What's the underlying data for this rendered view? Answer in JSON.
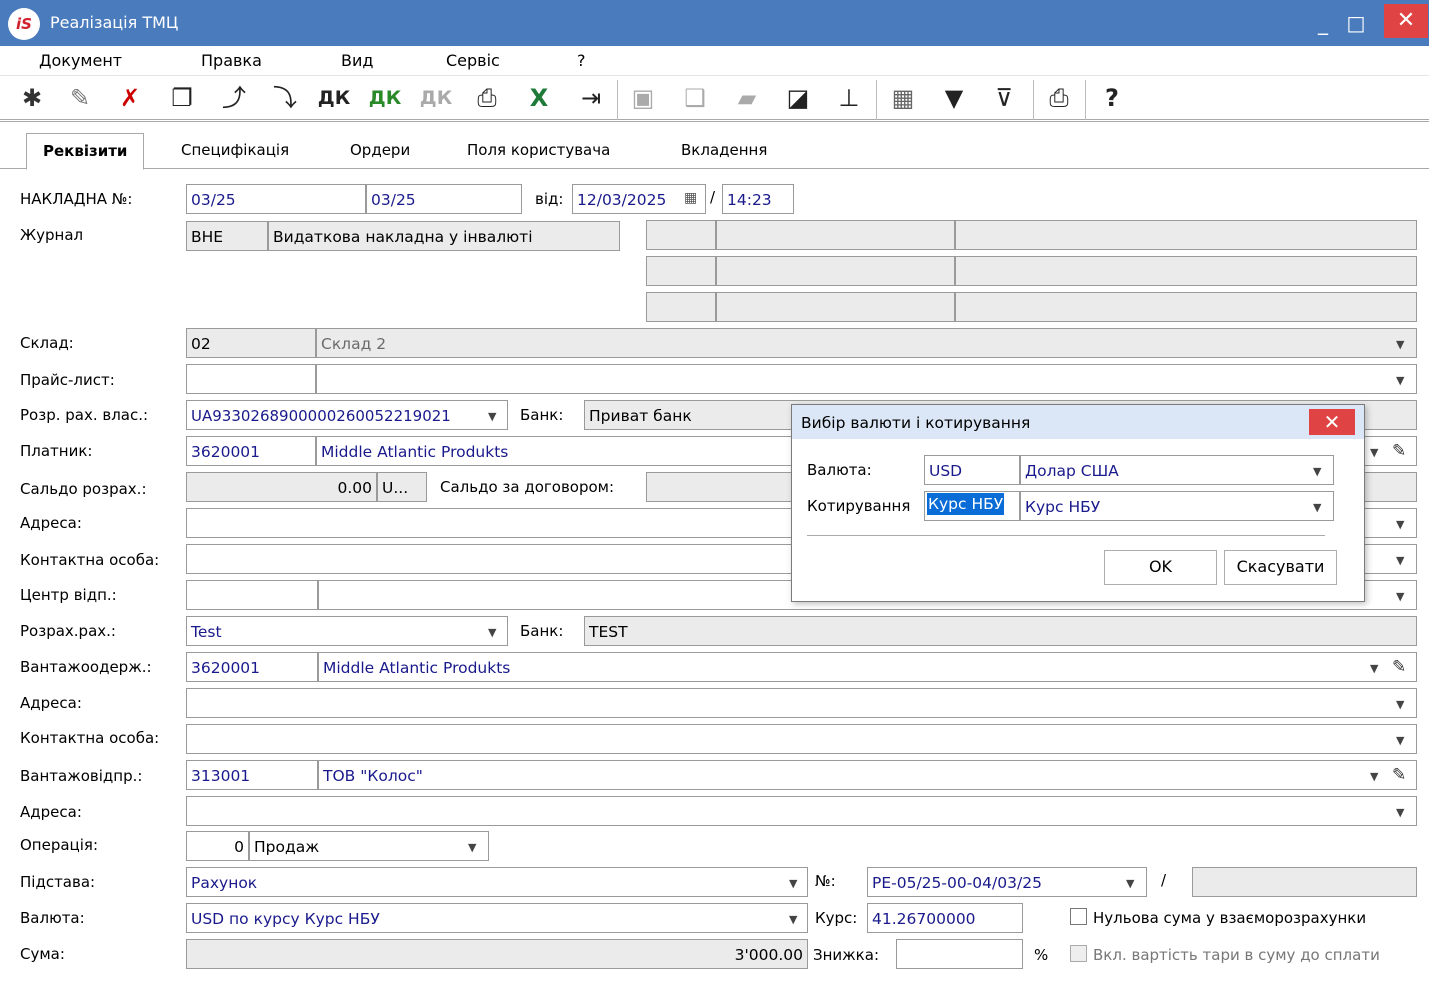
{
  "window": {
    "title": "Реалізація ТМЦ",
    "logo": "iS",
    "minimize": "_",
    "maximize": "□",
    "close": "✕"
  },
  "menu": [
    "Документ",
    "Правка",
    "Вид",
    "Сервіс",
    "?"
  ],
  "toolbar_icons": [
    "create-icon",
    "edit-icon",
    "delete-icon",
    "copy-icon",
    "link-up-icon",
    "link-down-icon",
    "dk-icon",
    "dk-green-icon",
    "dk-disabled-icon",
    "print-preview-icon",
    "excel-icon",
    "export-icon",
    "save-icon",
    "book-icon",
    "folder-icon",
    "window-icon",
    "tree-icon",
    "grid-icon",
    "filter-icon",
    "clear-filter-icon",
    "print-icon",
    "help-icon"
  ],
  "tabs": [
    "Реквізити",
    "Специфікація",
    "Ордери",
    "Поля користувача",
    "Вкладення"
  ],
  "form": {
    "invoice_label": "НАКЛАДНА №:",
    "invoice_no1": "03/25",
    "invoice_no2": "03/25",
    "from_label": "від:",
    "date": "12/03/2025",
    "slash": "/",
    "time": "14:23",
    "journal_label": "Журнал",
    "journal_code": "ВНЕ",
    "journal_name": "Видаткова накладна у інвалюті",
    "warehouse_label": "Склад:",
    "warehouse_code": "02",
    "warehouse_name": "Склад 2",
    "pricelist_label": "Прайс-лист:",
    "pricelist_code": "",
    "pricelist_name": "",
    "own_account_label": "Розр. рах. влас.:",
    "own_account": "UA933026890000026005221902​1",
    "bank_label": "Банк:",
    "own_bank": "Приват банк",
    "payer_label": "Платник:",
    "payer_code": "3620001",
    "payer_name": "Middle Atlantic Produkts",
    "balance_label": "Сальдо розрах.:",
    "balance_value": "0.00",
    "balance_cur": "U...",
    "contract_balance_label": "Сальдо за договором:",
    "address_label": "Адреса:",
    "contact_label": "Контактна особа:",
    "center_label": "Центр відп.:",
    "settle_account_label": "Розрах.рах.:",
    "settle_account": "Test",
    "settle_bank": "TEST",
    "consignee_label": "Вантажоодерж.:",
    "consignee_code": "3620001",
    "consignee_name": "Middle Atlantic Produkts",
    "shipper_label": "Вантажовідпр.:",
    "shipper_code": "313001",
    "shipper_name": "ТОВ \"Колос\"",
    "operation_label": "Операція:",
    "operation_code": "0",
    "operation_name": "Продаж",
    "basis_label": "Підстава:",
    "basis_value": "Рахунок",
    "number_label": "№:",
    "number_value": "РЕ-05/25-00-04/03/25",
    "currency_label": "Валюта:",
    "currency_value": "USD по курсу Курс НБУ",
    "rate_label": "Курс:",
    "rate_value": "41.26700000",
    "zero_sum_label": "Нульова сума у взаєморозрахунки",
    "sum_label": "Сума:",
    "sum_value": "3'000.00",
    "discount_label": "Знижка:",
    "percent": "%",
    "tare_label": "Вкл. вартість тари в суму до сплати"
  },
  "dialog": {
    "title": "Вибір валюти і котирування",
    "currency_label": "Валюта:",
    "currency_code": "USD",
    "currency_name": "Долар США",
    "quote_label": "Котирування",
    "quote_code": "Курс НБУ",
    "quote_name": "Курс НБУ",
    "ok": "OK",
    "cancel": "Скасувати"
  }
}
